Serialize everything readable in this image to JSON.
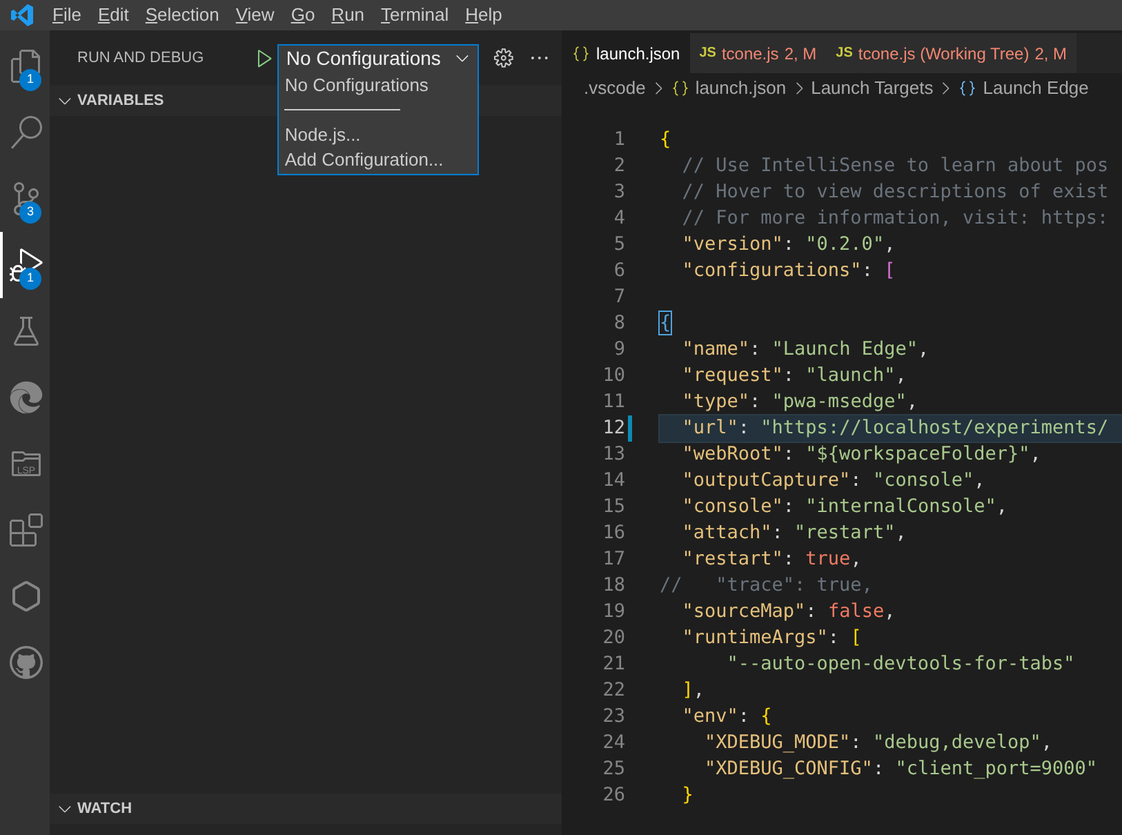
{
  "menu": [
    "File",
    "Edit",
    "Selection",
    "View",
    "Go",
    "Run",
    "Terminal",
    "Help"
  ],
  "activity_bar": [
    {
      "kind": "files",
      "badge": "1",
      "selected": false
    },
    {
      "kind": "search",
      "selected": false
    },
    {
      "kind": "source-control",
      "badge": "3",
      "selected": false
    },
    {
      "kind": "run-debug",
      "badge": "1",
      "selected": true
    },
    {
      "kind": "flask",
      "selected": false
    },
    {
      "kind": "swirl",
      "selected": false
    },
    {
      "kind": "folder",
      "label": "LSP",
      "selected": false
    },
    {
      "kind": "extensions",
      "selected": false
    },
    {
      "kind": "hexagon",
      "selected": false
    },
    {
      "kind": "github",
      "selected": false
    }
  ],
  "sidebar": {
    "title": "RUN AND DEBUG",
    "config_select": {
      "value": "No Configurations",
      "expanded": true,
      "options": [
        {
          "kind": "option",
          "label": "No Configurations"
        },
        {
          "kind": "separator"
        },
        {
          "kind": "option",
          "label": "Node.js..."
        },
        {
          "kind": "option",
          "label": "Add Configuration..."
        }
      ]
    },
    "sections": [
      {
        "title": "VARIABLES",
        "expanded": true
      },
      {
        "title": "WATCH",
        "expanded": true
      }
    ]
  },
  "tabs": [
    {
      "kind": "json",
      "label": "launch.json",
      "has_problems": false,
      "selected": true
    },
    {
      "kind": "js",
      "icon_text": "JS",
      "label": "tcone.js",
      "badge": "2, M",
      "has_problems": true,
      "selected": false
    },
    {
      "kind": "js",
      "icon_text": "JS",
      "label": "tcone.js (Working Tree)",
      "badge": "2, M",
      "has_problems": true,
      "selected": false
    }
  ],
  "breadcrumbs": [
    {
      "kind": "plain",
      "label": ".vscode"
    },
    {
      "kind": "json",
      "label": "launch.json"
    },
    {
      "kind": "plain",
      "label": "Launch Targets"
    },
    {
      "kind": "object",
      "label": "Launch Edge"
    }
  ],
  "code_lines": [
    {
      "number": "1",
      "current": false,
      "tokens": [
        {
          "kind": "brace",
          "text": "{"
        }
      ]
    },
    {
      "number": "2",
      "current": false,
      "tokens": [
        {
          "kind": "comment",
          "text": "  // Use IntelliSense to learn about pos"
        }
      ]
    },
    {
      "number": "3",
      "current": false,
      "tokens": [
        {
          "kind": "comment",
          "text": "  // Hover to view descriptions of exist"
        }
      ]
    },
    {
      "number": "4",
      "current": false,
      "tokens": [
        {
          "kind": "comment",
          "text": "  // For more information, visit: https:"
        }
      ]
    },
    {
      "number": "5",
      "current": false,
      "tokens": [
        {
          "kind": "key",
          "text": "  \"version\""
        },
        {
          "kind": "punct",
          "text": ": "
        },
        {
          "kind": "string",
          "text": "\"0.2.0\""
        },
        {
          "kind": "punct",
          "text": ","
        }
      ]
    },
    {
      "number": "6",
      "current": false,
      "tokens": [
        {
          "kind": "key",
          "text": "  \"configurations\""
        },
        {
          "kind": "punct",
          "text": ": "
        },
        {
          "kind": "bracket",
          "text": "["
        }
      ]
    },
    {
      "number": "7",
      "current": false
    },
    {
      "number": "8",
      "current": false,
      "tokens": [
        {
          "kind": "matched",
          "text": "{"
        }
      ]
    },
    {
      "number": "9",
      "current": false,
      "tokens": [
        {
          "kind": "key",
          "text": "  \"name\""
        },
        {
          "kind": "punct",
          "text": ": "
        },
        {
          "kind": "string",
          "text": "\"Launch Edge\""
        },
        {
          "kind": "punct",
          "text": ","
        }
      ]
    },
    {
      "number": "10",
      "current": false,
      "tokens": [
        {
          "kind": "key",
          "text": "  \"request\""
        },
        {
          "kind": "punct",
          "text": ": "
        },
        {
          "kind": "string",
          "text": "\"launch\""
        },
        {
          "kind": "punct",
          "text": ","
        }
      ]
    },
    {
      "number": "11",
      "current": false,
      "tokens": [
        {
          "kind": "key",
          "text": "  \"type\""
        },
        {
          "kind": "punct",
          "text": ": "
        },
        {
          "kind": "string",
          "text": "\"pwa-msedge\""
        },
        {
          "kind": "punct",
          "text": ","
        }
      ]
    },
    {
      "number": "12",
      "current": true,
      "tokens": [
        {
          "kind": "key",
          "text": "  \"url\""
        },
        {
          "kind": "punct",
          "text": ": "
        },
        {
          "kind": "string",
          "text": "\"https://localhost/experiments/"
        }
      ]
    },
    {
      "number": "13",
      "current": false,
      "tokens": [
        {
          "kind": "key",
          "text": "  \"webRoot\""
        },
        {
          "kind": "punct",
          "text": ": "
        },
        {
          "kind": "string",
          "text": "\"${workspaceFolder}\""
        },
        {
          "kind": "punct",
          "text": ","
        }
      ]
    },
    {
      "number": "14",
      "current": false,
      "tokens": [
        {
          "kind": "key",
          "text": "  \"outputCapture\""
        },
        {
          "kind": "punct",
          "text": ": "
        },
        {
          "kind": "string",
          "text": "\"console\""
        },
        {
          "kind": "punct",
          "text": ","
        }
      ]
    },
    {
      "number": "15",
      "current": false,
      "tokens": [
        {
          "kind": "key",
          "text": "  \"console\""
        },
        {
          "kind": "punct",
          "text": ": "
        },
        {
          "kind": "string",
          "text": "\"internalConsole\""
        },
        {
          "kind": "punct",
          "text": ","
        }
      ]
    },
    {
      "number": "16",
      "current": false,
      "tokens": [
        {
          "kind": "key",
          "text": "  \"attach\""
        },
        {
          "kind": "punct",
          "text": ": "
        },
        {
          "kind": "string",
          "text": "\"restart\""
        },
        {
          "kind": "punct",
          "text": ","
        }
      ]
    },
    {
      "number": "17",
      "current": false,
      "tokens": [
        {
          "kind": "key",
          "text": "  \"restart\""
        },
        {
          "kind": "punct",
          "text": ": "
        },
        {
          "kind": "literal",
          "text": "true"
        },
        {
          "kind": "punct",
          "text": ","
        }
      ]
    },
    {
      "number": "18",
      "current": false,
      "tokens": [
        {
          "kind": "comment",
          "text": "//   \"trace\": true,"
        }
      ]
    },
    {
      "number": "19",
      "current": false,
      "tokens": [
        {
          "kind": "key",
          "text": "  \"sourceMap\""
        },
        {
          "kind": "punct",
          "text": ": "
        },
        {
          "kind": "literal",
          "text": "false"
        },
        {
          "kind": "punct",
          "text": ","
        }
      ]
    },
    {
      "number": "20",
      "current": false,
      "tokens": [
        {
          "kind": "key",
          "text": "  \"runtimeArgs\""
        },
        {
          "kind": "punct",
          "text": ": "
        },
        {
          "kind": "brace",
          "text": "["
        }
      ]
    },
    {
      "number": "21",
      "current": false,
      "tokens": [
        {
          "kind": "string",
          "text": "      \"--auto-open-devtools-for-tabs\""
        }
      ]
    },
    {
      "number": "22",
      "current": false,
      "tokens": [
        {
          "kind": "brace",
          "text": "  ]"
        },
        {
          "kind": "punct",
          "text": ","
        }
      ]
    },
    {
      "number": "23",
      "current": false,
      "tokens": [
        {
          "kind": "key",
          "text": "  \"env\""
        },
        {
          "kind": "punct",
          "text": ": "
        },
        {
          "kind": "brace",
          "text": "{"
        }
      ]
    },
    {
      "number": "24",
      "current": false,
      "tokens": [
        {
          "kind": "key",
          "text": "    \"XDEBUG_MODE\""
        },
        {
          "kind": "punct",
          "text": ": "
        },
        {
          "kind": "string",
          "text": "\"debug,develop\""
        },
        {
          "kind": "punct",
          "text": ","
        }
      ]
    },
    {
      "number": "25",
      "current": false,
      "tokens": [
        {
          "kind": "key",
          "text": "    \"XDEBUG_CONFIG\""
        },
        {
          "kind": "punct",
          "text": ": "
        },
        {
          "kind": "string",
          "text": "\"client_port=9000\""
        }
      ]
    },
    {
      "number": "26",
      "current": false,
      "tokens": [
        {
          "kind": "brace",
          "text": "  }"
        }
      ]
    }
  ]
}
